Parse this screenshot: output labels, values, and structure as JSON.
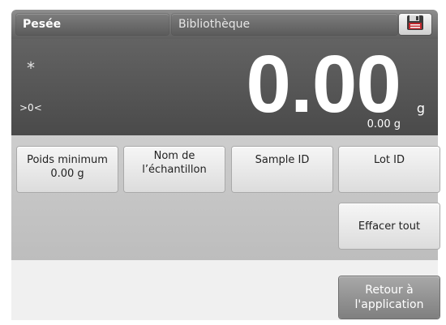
{
  "topbar": {
    "tab_weigh": "Pesée",
    "tab_library": "Bibliothèque",
    "save_icon": "floppy-disk-icon"
  },
  "display": {
    "stable_indicator": "*",
    "zero_indicator": ">0<",
    "reading": "0.00",
    "unit": "g",
    "secondary_reading": "0.00 g"
  },
  "buttons": {
    "min_weight_label": "Poids minimum",
    "min_weight_value": "0.00 g",
    "sample_name_line1": "Nom de",
    "sample_name_line2": "l’échantillon",
    "sample_id": "Sample ID",
    "lot_id": "Lot ID",
    "clear_all": "Effacer tout"
  },
  "footer": {
    "return_line1": "Retour à",
    "return_line2": "l'application"
  },
  "colors": {
    "display_bg": "#555555",
    "content_bg": "#c6c6c6",
    "button_bg": "#ececec",
    "return_button_bg": "#939393"
  }
}
